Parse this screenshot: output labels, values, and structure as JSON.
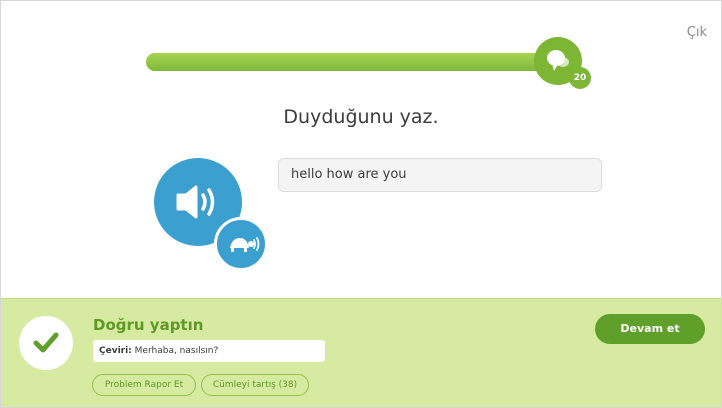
{
  "header": {
    "quit_label": "Çık",
    "progress_fraction": 0.95,
    "streak_count": "20",
    "progress_icon": "speech-bubbles-icon"
  },
  "challenge": {
    "prompt": "Duyduğunu yaz.",
    "play_icon": "speaker-icon",
    "slow_play_icon": "turtle-icon",
    "answer_value": "hello how are you"
  },
  "feedback": {
    "status_icon": "checkmark-icon",
    "title": "Doğru yaptın",
    "translation_label": "Çeviri:",
    "translation_text": "Merhaba, nasılsın?",
    "report_label": "Problem Rapor Et",
    "discuss_label": "Cümleyi tartış (38)",
    "continue_label": "Devam et"
  },
  "colors": {
    "accent_green": "#7db535",
    "speaker_blue": "#3b9fd0",
    "footer_bg": "#d6eaa2",
    "continue_bg": "#5f9f2a"
  }
}
